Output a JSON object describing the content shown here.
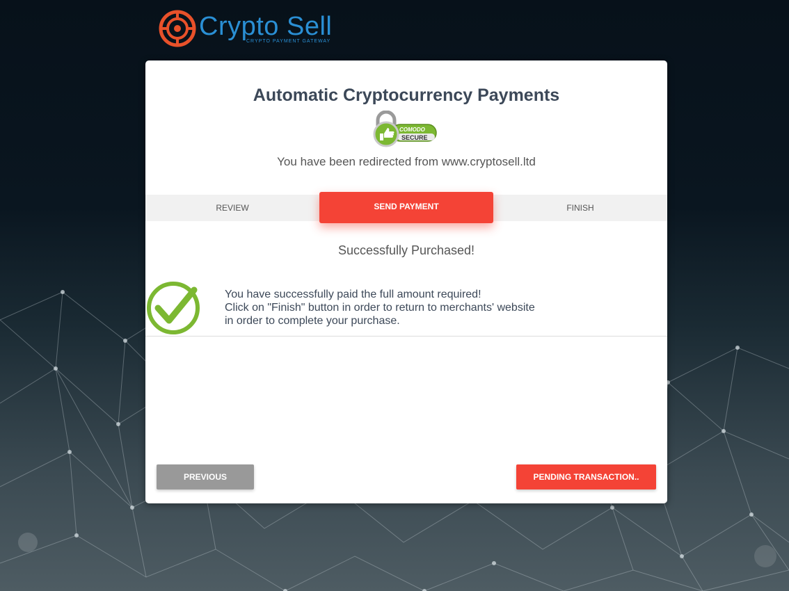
{
  "brand": {
    "name": "Crypto Sell",
    "tagline": "CRYPTO PAYMENT GATEWAY",
    "color": "#2a8fd4",
    "icon_color": "#e8512a"
  },
  "card": {
    "title": "Automatic Cryptocurrency Payments",
    "badge": {
      "line1": "COMODO",
      "line2": "SECURE",
      "icon": "padlock-thumbs-up-icon"
    },
    "redirect_text": "You have been redirected from www.cryptosell.ltd"
  },
  "steps": [
    {
      "label": "REVIEW",
      "active": false
    },
    {
      "label": "SEND PAYMENT",
      "active": true
    },
    {
      "label": "FINISH",
      "active": false
    }
  ],
  "result": {
    "title": "Successfully Purchased!",
    "icon": "check-circle-icon",
    "lines": [
      "You have successfully paid the full amount required!",
      "Click on \"Finish\" button in order to return to merchants' website",
      "in order to complete your purchase."
    ]
  },
  "buttons": {
    "previous": "PREVIOUS",
    "pending": "PENDING TRANSACTION.."
  },
  "colors": {
    "accent": "#f44336",
    "success": "#7cb832",
    "muted_button": "#999999"
  }
}
